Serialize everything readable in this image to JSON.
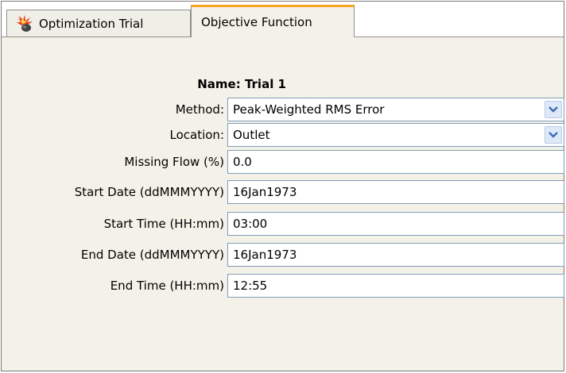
{
  "tabs": [
    {
      "label": "Optimization Trial",
      "icon": "explosion-icon",
      "active": false
    },
    {
      "label": "Objective Function",
      "active": true
    }
  ],
  "form": {
    "name": "Name: Trial 1",
    "method": {
      "label": "Method:",
      "value": "Peak-Weighted RMS Error"
    },
    "location": {
      "label": "Location:",
      "value": "Outlet"
    },
    "missing_flow": {
      "label": "Missing Flow (%)",
      "value": "0.0"
    },
    "start_date": {
      "label": "Start Date (ddMMMYYYY)",
      "value": "16Jan1973"
    },
    "start_time": {
      "label": "Start Time (HH:mm)",
      "value": "03:00"
    },
    "end_date": {
      "label": "End Date (ddMMMYYYY)",
      "value": "16Jan1973"
    },
    "end_time": {
      "label": "End Time (HH:mm)",
      "value": "12:55"
    }
  },
  "colors": {
    "active_tab_accent": "#f6a524",
    "panel_background": "#f4f2e8",
    "field_border": "#7f9db9",
    "dropdown_arrow": "#3b6fb6"
  }
}
